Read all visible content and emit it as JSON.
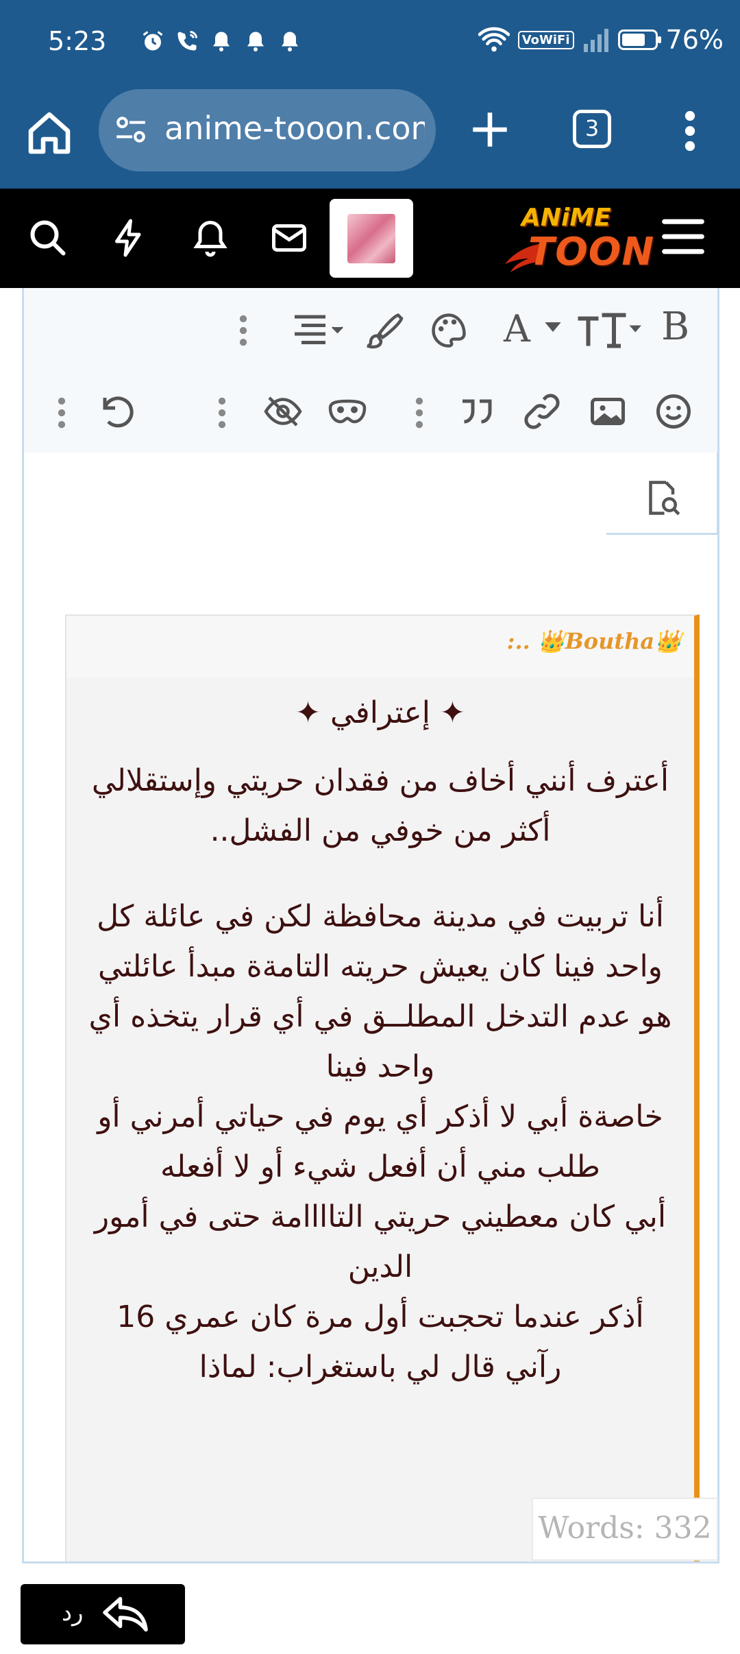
{
  "status_bar": {
    "time": "5:23",
    "vowifi": "VoWiFi",
    "battery": "76%",
    "battery_level": 0.76
  },
  "browser": {
    "url": "anime-tooon.com",
    "tab_count": "3"
  },
  "site_header": {
    "logo_line1": "ANiME",
    "logo_line2": "TOON"
  },
  "editor": {
    "toolbar_row1": [
      "bold-icon",
      "text-size-icon",
      "font-family-icon",
      "color-palette-icon",
      "brush-icon",
      "align-icon",
      "more-options"
    ],
    "toolbar_row2": [
      "smiley-icon",
      "image-icon",
      "link-icon",
      "quote-icon",
      "more-options",
      "spoiler-mask-icon",
      "hide-eye-icon",
      "more-options",
      "undo-icon",
      "more-options"
    ],
    "bold_label": "B",
    "font_label": "A",
    "quote": {
      "author": ":.. 👑Boutha👑",
      "title": "✦ إعترافي ✦",
      "para1": "أعترف أنني أخاف من فقدان حريتي وإستقلالي أكثر من خوفي من الفشل..",
      "para2": "أنا تربيت في مدينة محافظة لكن في عائلة كل واحد فينا كان يعيش حريته التامةة مبدأ عائلتي هو عدم التدخل المطلــق في أي قرار يتخذه أي واحد فينا",
      "para3": "خاصةة أبي لا أذكر أي يوم في حياتي أمرني أو طلب مني أن أفعل شيء أو لا أفعله",
      "para4": "أبي كان معطيني حريتي التاااامة حتى في أمور الدين",
      "para5": "أذكر عندما تحجبت أول مرة كان عمري 16",
      "para6": "رآني قال لي باستغراب: لماذا"
    },
    "word_count": "Words: 332"
  },
  "reply_button": {
    "label": "رد"
  },
  "colors": {
    "chrome_blue": "#1e5a8e",
    "url_box": "#4f7ea9",
    "quote_accent": "#e8911a",
    "quote_text": "#3e1010"
  }
}
